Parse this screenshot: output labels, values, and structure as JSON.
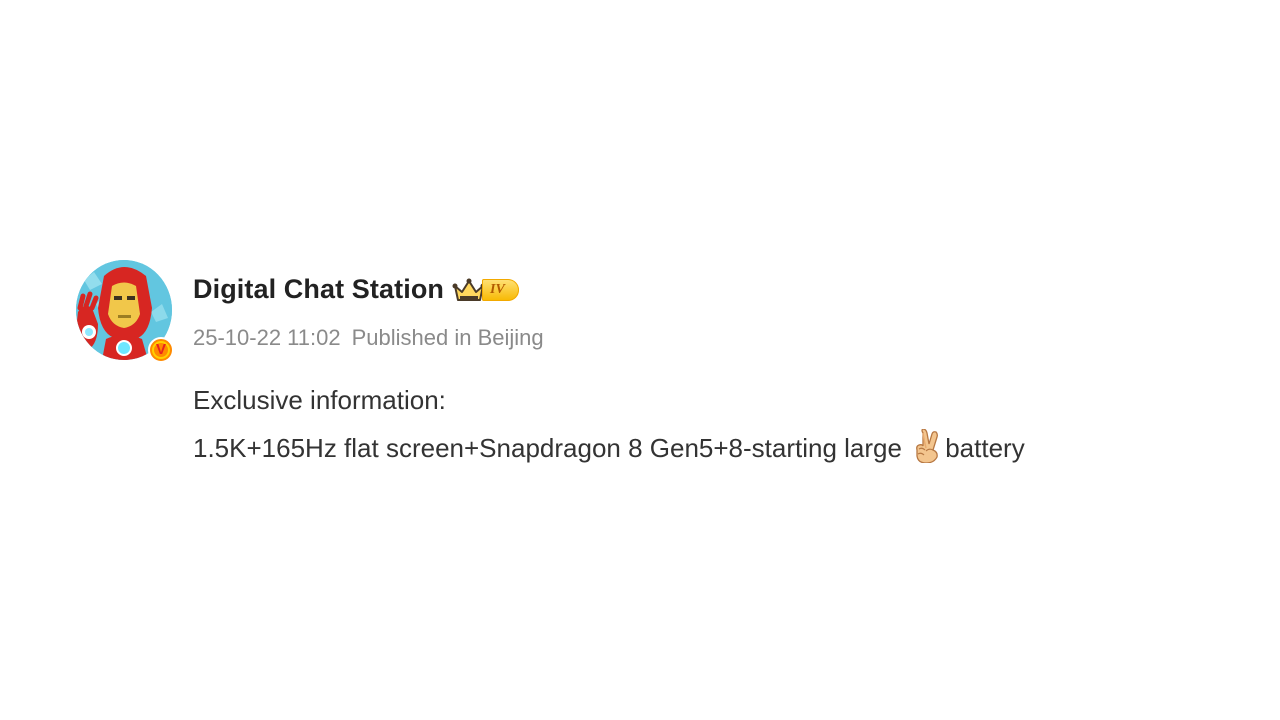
{
  "post": {
    "author": {
      "name": "Digital Chat Station",
      "avatar_icon": "iron-man-avatar",
      "verified_badge_text": "V",
      "level_label": "IV",
      "level_icon": "crown-icon"
    },
    "meta": {
      "timestamp": "25-10-22 11:02",
      "location": "Published in Beijing"
    },
    "content": {
      "line1": "Exclusive information:",
      "line2_before_emoji": "1.5K+165Hz flat screen+Snapdragon 8 Gen5+8-starting large ",
      "emoji": "victory-hand-emoji",
      "line2_after_emoji": "battery"
    },
    "colors": {
      "name_text": "#222222",
      "meta_text": "#8a8a8a",
      "body_text": "#333333",
      "badge_orange": "#ff8a00",
      "level_gold": "#f7b800"
    }
  }
}
